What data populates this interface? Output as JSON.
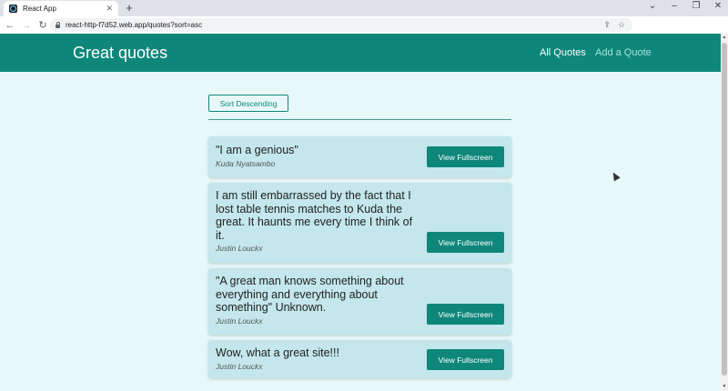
{
  "browser": {
    "tab_title": "React App",
    "url": "react-http-f7d52.web.app/quotes?sort=asc",
    "profile_initial": "J"
  },
  "site": {
    "logo": "Great quotes",
    "nav": [
      {
        "label": "All Quotes",
        "active": true
      },
      {
        "label": "Add a Quote",
        "active": false
      }
    ]
  },
  "sort_button": "Sort Descending",
  "quotes": [
    {
      "text": "\"I am a genious\"",
      "author": "Kuda Nyatsambo",
      "button": "View Fullscreen"
    },
    {
      "text": "I am still embarrassed by the fact that I lost table tennis matches to Kuda the great. It haunts me every time I think of it.",
      "author": "Justin Louckx",
      "button": "View Fullscreen"
    },
    {
      "text": "\"A great man knows something about everything and everything about something\" Unknown.",
      "author": "Justin Louckx",
      "button": "View Fullscreen"
    },
    {
      "text": "Wow, what a great site!!!",
      "author": "Justin Louckx",
      "button": "View Fullscreen"
    }
  ],
  "colors": {
    "accent": "#0e877a",
    "card": "#c3e7ec",
    "page_bg": "#e8f8f8"
  },
  "icons": [
    "back-icon",
    "forward-icon",
    "reload-icon",
    "lock-icon",
    "share-icon",
    "star-icon",
    "extensions-icon",
    "sidebar-icon",
    "menu-icon"
  ]
}
